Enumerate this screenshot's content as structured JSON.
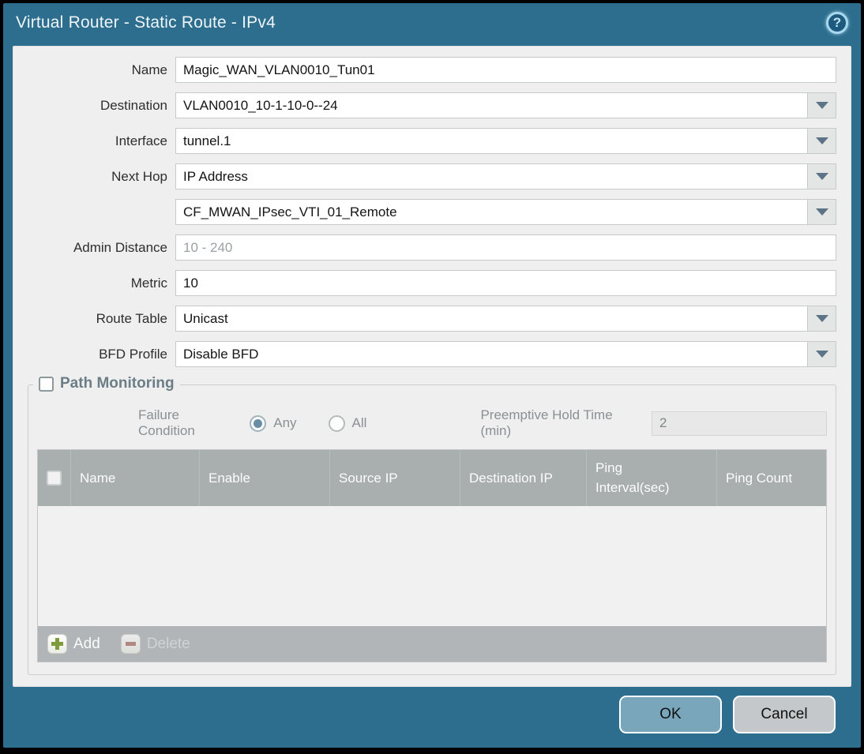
{
  "dialog": {
    "title": "Virtual Router - Static Route - IPv4",
    "help_glyph": "?"
  },
  "form": {
    "name": {
      "label": "Name",
      "value": "Magic_WAN_VLAN0010_Tun01"
    },
    "destination": {
      "label": "Destination",
      "value": "VLAN0010_10-1-10-0--24"
    },
    "interface": {
      "label": "Interface",
      "value": "tunnel.1"
    },
    "next_hop": {
      "label": "Next Hop",
      "value": "IP Address"
    },
    "next_hop_address": {
      "value": "CF_MWAN_IPsec_VTI_01_Remote"
    },
    "admin_distance": {
      "label": "Admin Distance",
      "placeholder": "10 - 240",
      "value": ""
    },
    "metric": {
      "label": "Metric",
      "value": "10"
    },
    "route_table": {
      "label": "Route Table",
      "value": "Unicast"
    },
    "bfd_profile": {
      "label": "BFD Profile",
      "value": "Disable BFD"
    }
  },
  "path_monitoring": {
    "title": "Path Monitoring",
    "enabled": false,
    "failure_condition_label": "Failure Condition",
    "option_any": "Any",
    "option_all": "All",
    "selected_option": "Any",
    "preemptive_label": "Preemptive Hold Time (min)",
    "preemptive_value": "2",
    "table": {
      "columns": [
        "Name",
        "Enable",
        "Source IP",
        "Destination IP",
        "Ping Interval(sec)",
        "Ping Count"
      ],
      "rows": []
    },
    "add_label": "Add",
    "delete_label": "Delete"
  },
  "footer": {
    "ok_label": "OK",
    "cancel_label": "Cancel"
  },
  "colors": {
    "frame_teal": "#2d6e8e",
    "panel_bg": "#eeefee",
    "table_header_bg": "#a9aeae",
    "toolbar_bg": "#b1b5b7",
    "ok_button_bg": "#7aa6bc",
    "cancel_button_bg": "#c4c8cb",
    "add_icon_green": "#7e9c3c",
    "delete_icon_red": "#b07a70"
  }
}
